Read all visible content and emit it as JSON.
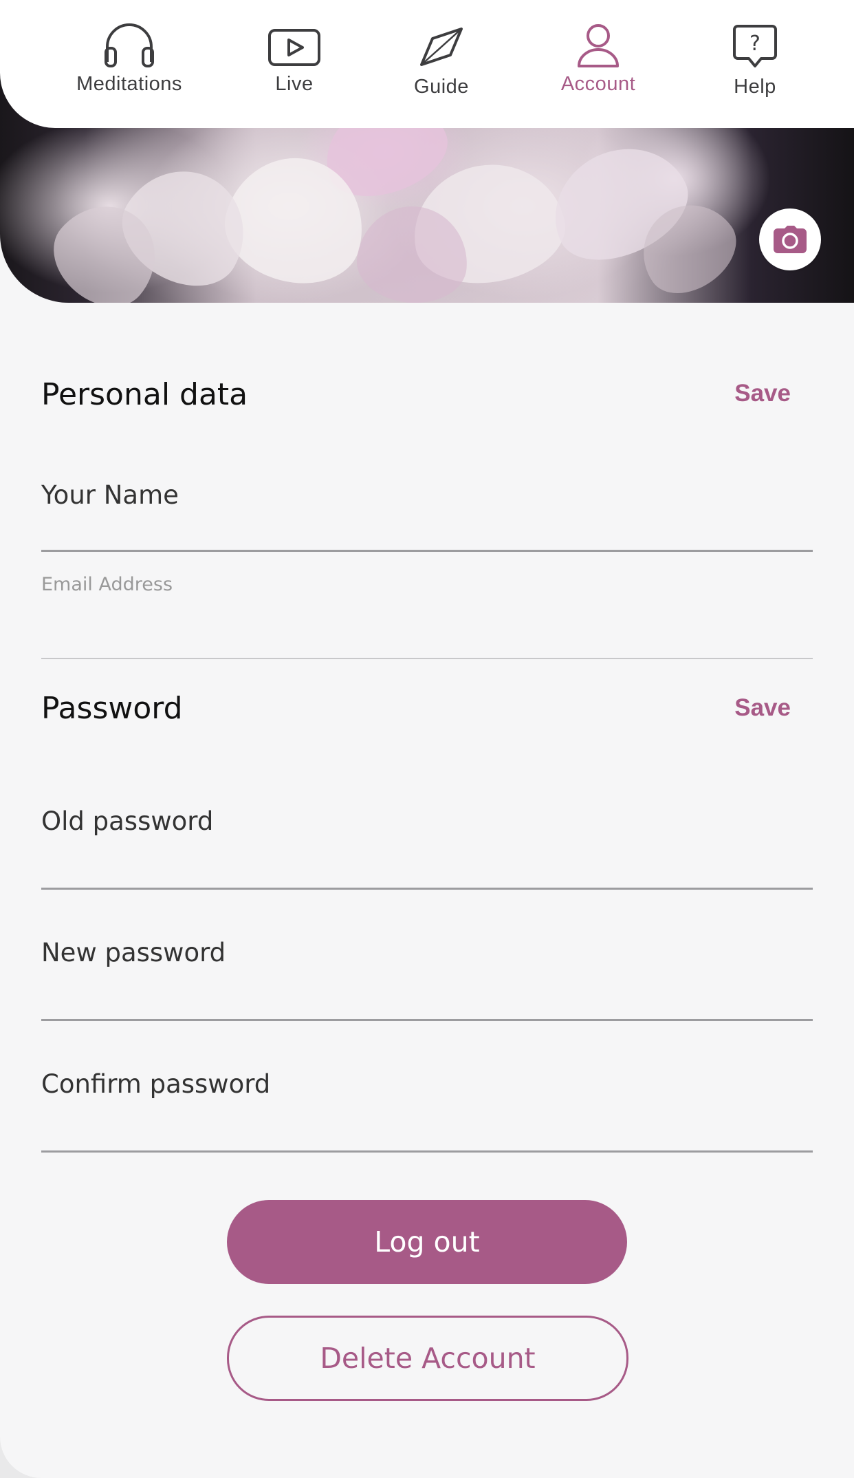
{
  "nav": {
    "tabs": [
      {
        "label": "Meditations",
        "icon": "headphones-icon",
        "active": false
      },
      {
        "label": "Live",
        "icon": "play-icon",
        "active": false
      },
      {
        "label": "Guide",
        "icon": "compass-icon",
        "active": false
      },
      {
        "label": "Account",
        "icon": "user-icon",
        "active": true
      },
      {
        "label": "Help",
        "icon": "question-bubble-icon",
        "active": false
      }
    ]
  },
  "profile": {
    "camera_icon": "camera-icon"
  },
  "personal": {
    "title": "Personal data",
    "save_label": "Save",
    "name_label": "Your Name",
    "email_label": "Email Address"
  },
  "password": {
    "title": "Password",
    "save_label": "Save",
    "old_label": "Old password",
    "new_label": "New password",
    "confirm_label": "Confirm password"
  },
  "actions": {
    "logout_label": "Log out",
    "delete_label": "Delete Account"
  },
  "colors": {
    "accent": "#a75a87",
    "background": "#f6f6f7",
    "tabbar": "#ffffff"
  }
}
